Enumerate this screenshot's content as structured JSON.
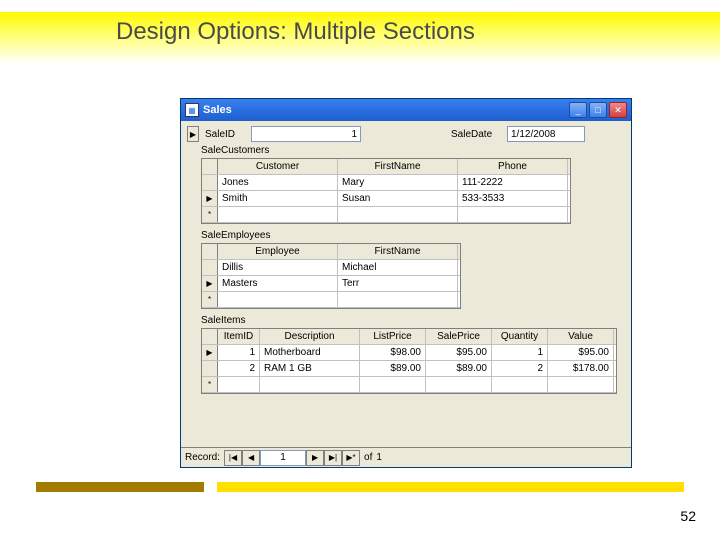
{
  "title": "Design Options: Multiple Sections",
  "page_number": "52",
  "window": {
    "title": "Sales",
    "fields": {
      "saleid_label": "SaleID",
      "saleid_value": "1",
      "saledate_label": "SaleDate",
      "saledate_value": "1/12/2008"
    },
    "customers": {
      "section_label": "SaleCustomers",
      "headers": {
        "c1": "Customer",
        "c2": "FirstName",
        "c3": "Phone"
      },
      "rows": [
        {
          "c1": "Jones",
          "c2": "Mary",
          "c3": "111-2222"
        },
        {
          "c1": "Smith",
          "c2": "Susan",
          "c3": "533-3533"
        }
      ]
    },
    "employees": {
      "section_label": "SaleEmployees",
      "headers": {
        "c1": "Employee",
        "c2": "FirstName"
      },
      "rows": [
        {
          "c1": "Dillis",
          "c2": "Michael"
        },
        {
          "c1": "Masters",
          "c2": "Terr"
        }
      ]
    },
    "items": {
      "section_label": "SaleItems",
      "headers": {
        "c1": "ItemID",
        "c2": "Description",
        "c3": "ListPrice",
        "c4": "SalePrice",
        "c5": "Quantity",
        "c6": "Value"
      },
      "rows": [
        {
          "c1": "1",
          "c2": "Motherboard",
          "c3": "$98.00",
          "c4": "$95.00",
          "c5": "1",
          "c6": "$95.00"
        },
        {
          "c1": "2",
          "c2": "RAM 1 GB",
          "c3": "$89.00",
          "c4": "$89.00",
          "c5": "2",
          "c6": "$178.00"
        }
      ]
    },
    "nav": {
      "label": "Record:",
      "current": "1",
      "of_label": "of",
      "total": "1"
    }
  }
}
